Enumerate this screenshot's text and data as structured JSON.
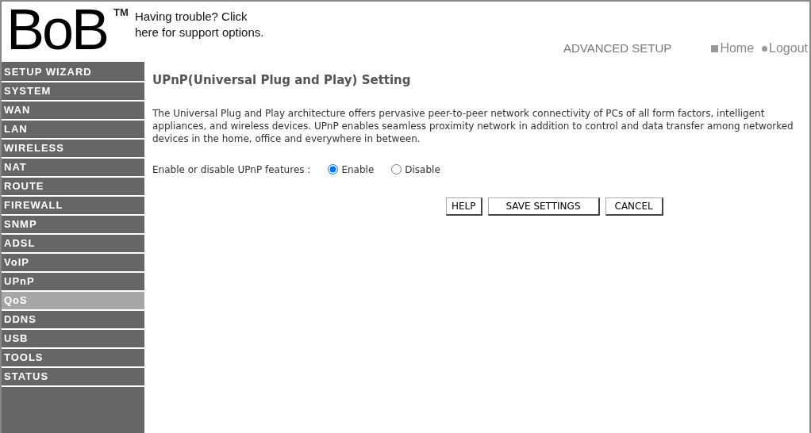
{
  "header": {
    "logo": "BoB",
    "trademark": "TM",
    "support_link": "Having trouble? Click here for support options.",
    "section": "ADVANCED SETUP",
    "links": [
      {
        "label": "Home",
        "kind": "square"
      },
      {
        "label": "Logout",
        "kind": "dot"
      }
    ]
  },
  "sidebar": {
    "items": [
      {
        "label": "SETUP WIZARD",
        "selected": false
      },
      {
        "label": "SYSTEM",
        "selected": false
      },
      {
        "label": "WAN",
        "selected": false
      },
      {
        "label": "LAN",
        "selected": false
      },
      {
        "label": "WIRELESS",
        "selected": false
      },
      {
        "label": "NAT",
        "selected": false
      },
      {
        "label": "ROUTE",
        "selected": false
      },
      {
        "label": "FIREWALL",
        "selected": false
      },
      {
        "label": "SNMP",
        "selected": false
      },
      {
        "label": "ADSL",
        "selected": false
      },
      {
        "label": "VoIP",
        "selected": false
      },
      {
        "label": "UPnP",
        "selected": false
      },
      {
        "label": "QoS",
        "selected": true
      },
      {
        "label": "DDNS",
        "selected": false
      },
      {
        "label": "USB",
        "selected": false
      },
      {
        "label": "TOOLS",
        "selected": false
      },
      {
        "label": "STATUS",
        "selected": false
      }
    ]
  },
  "content": {
    "title": "UPnP(Universal Plug and Play) Setting",
    "description": "The Universal Plug and Play architecture offers pervasive peer-to-peer network connectivity of PCs of all form factors, intelligent appliances, and wireless devices. UPnP enables seamless proximity network in addition to control and data transfer among networked devices in the home, office and everywhere in between.",
    "setting": {
      "label": "Enable or disable UPnP features :",
      "options": [
        {
          "label": "Enable",
          "selected": true
        },
        {
          "label": "Disable",
          "selected": false
        }
      ]
    },
    "buttons": [
      "HELP",
      "SAVE SETTINGS",
      "CANCEL"
    ]
  }
}
